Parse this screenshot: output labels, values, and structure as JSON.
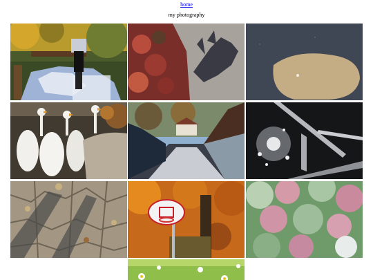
{
  "nav": {
    "home_label": "home"
  },
  "page": {
    "title": "my photography"
  },
  "photos": [
    {
      "icon": "autumn-garden-goose-statue-photo"
    },
    {
      "icon": "shadow-on-pavement-sedum-photo"
    },
    {
      "icon": "light-patch-on-gravel-photo"
    },
    {
      "icon": "geese-statues-planter-photo"
    },
    {
      "icon": "footbridge-photo"
    },
    {
      "icon": "sparkling-water-railing-photo"
    },
    {
      "icon": "cracked-earth-shadows-photo"
    },
    {
      "icon": "basketball-hoop-autumn-tree-photo"
    },
    {
      "icon": "flowering-succulents-photo"
    },
    {
      "icon": "daisies-in-grass-photo"
    }
  ]
}
